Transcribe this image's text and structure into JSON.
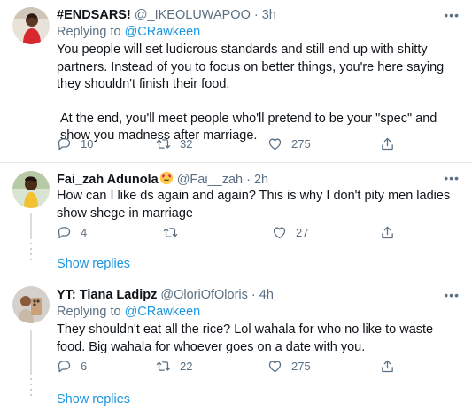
{
  "tweets": [
    {
      "name": "#ENDSARS!",
      "handle": "@_IKEOLUWAPOO",
      "time": "· 3h",
      "more_icon": "more-horizontal-icon",
      "reply_prefix": "Replying to",
      "reply_to": "@CRawkeen",
      "body": [
        "You people will set ludicrous standards and still end up with shitty partners. Instead of you to focus on better things, you're here saying they shouldn't finish their food.",
        "At the end, you'll meet people who'll pretend to be your \"spec\" and show you madness after marriage."
      ],
      "replies": "10",
      "retweets": "32",
      "likes": "275"
    },
    {
      "name": "Fai_zah Adunola",
      "emoji_icon": "smiling-face-with-heart-eyes-icon",
      "handle": "@Fai__zah",
      "time": "· 2h",
      "more_icon": "more-horizontal-icon",
      "body": [
        "How can I like ds again and again? This is why I don't pity men ladies show shege in marriage"
      ],
      "replies": "4",
      "retweets": "",
      "likes": "27",
      "show_replies": "Show replies"
    },
    {
      "name": "YT: Tiana Ladipz",
      "handle": "@OloriOfOloris",
      "time": "· 4h",
      "more_icon": "more-horizontal-icon",
      "reply_prefix": "Replying to",
      "reply_to": "@CRawkeen",
      "body": [
        "They shouldn't eat all the rice? Lol wahala for who no like to waste food. Big wahala for whoever goes on a date with you."
      ],
      "replies": "6",
      "retweets": "22",
      "likes": "275",
      "show_replies": "Show replies"
    }
  ],
  "more_glyph": "•••",
  "icons": {
    "reply": "reply-bubble-icon",
    "retweet": "retweet-icon",
    "like": "heart-icon",
    "share": "share-icon"
  },
  "colors": {
    "link": "#1b95e0",
    "secondary": "#5b7083",
    "divider": "#e1e8ed"
  }
}
